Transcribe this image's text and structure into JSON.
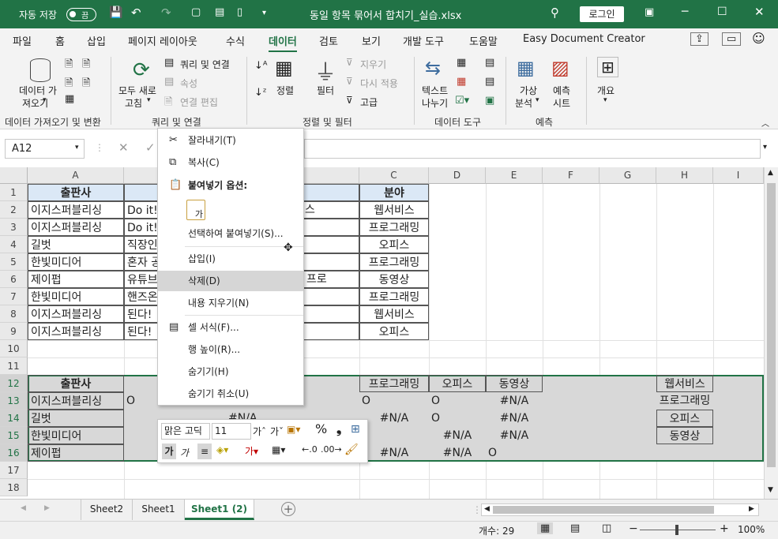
{
  "titlebar": {
    "autosave_label": "자동 저장",
    "autosave_state": "끔",
    "filename": "동일 항목 묶어서 합치기_실습.xlsx",
    "login_label": "로그인",
    "bg_color": "#217346"
  },
  "menu": {
    "items": [
      "파일",
      "홈",
      "삽입",
      "페이지 레이아웃",
      "수식",
      "데이터",
      "검토",
      "보기",
      "개발 도구",
      "도움말",
      "Easy Document Creator"
    ],
    "active": "데이터"
  },
  "ribbon": {
    "get_data_label1": "데이터 가",
    "get_data_label2": "져오기",
    "refresh_all_label1": "모두 새로",
    "refresh_all_label2": "고침",
    "queries_connections": "쿼리 및 연결",
    "properties": "속성",
    "edit_links": "연결 편집",
    "sort": "정렬",
    "filter": "필터",
    "clear": "지우기",
    "reapply": "다시 적용",
    "advanced": "고급",
    "text_to_columns1": "텍스트",
    "text_to_columns2": "나누기",
    "what_if1": "가상",
    "what_if2": "분석",
    "forecast1": "예측",
    "forecast2": "시트",
    "outline": "개요",
    "groups": [
      "데이터 가져오기 및 변환",
      "쿼리 및 연결",
      "정렬 및 필터",
      "데이터 도구",
      "예측"
    ]
  },
  "formula_bar": {
    "name_box": "A12"
  },
  "columns": [
    "A",
    "B",
    "C",
    "D",
    "E",
    "F",
    "G",
    "H",
    "I"
  ],
  "rows": [
    "1",
    "2",
    "3",
    "4",
    "5",
    "6",
    "7",
    "8",
    "9",
    "10",
    "11",
    "12",
    "13",
    "14",
    "15",
    "16",
    "17",
    "18"
  ],
  "table1": {
    "header_a": "출판사",
    "header_c": "분야",
    "rows": [
      {
        "a": "이지스퍼블리싱",
        "b": "Do it!",
        "b2": "스",
        "c": "웹서비스"
      },
      {
        "a": "이지스퍼블리싱",
        "b": "Do it!",
        "b2": "",
        "c": "프로그래밍"
      },
      {
        "a": "길벗",
        "b": "직장인",
        "b2": "",
        "c": "오피스"
      },
      {
        "a": "한빛미디어",
        "b": "혼자 공",
        "b2": "",
        "c": "프로그래밍"
      },
      {
        "a": "제이펍",
        "b": "유튜브",
        "b2": "프로",
        "c": "동영상"
      },
      {
        "a": "한빛미디어",
        "b": "핸즈온",
        "b2": "",
        "c": "프로그래밍"
      },
      {
        "a": "이지스퍼블리싱",
        "b": "된다!",
        "b2": "",
        "c": "웹서비스"
      },
      {
        "a": "이지스퍼블리싱",
        "b": "된다!",
        "b2": "",
        "c": "오피스"
      }
    ]
  },
  "table2": {
    "header_a": "출판사",
    "header_c": "프로그래밍",
    "header_d": "오피스",
    "header_e": "동영상",
    "rows": [
      {
        "a": "이지스퍼블리싱",
        "b": "O",
        "c": "O",
        "d": "O",
        "e": "#N/A"
      },
      {
        "a": "길벗",
        "b": "#N/A",
        "c": "#N/A",
        "d": "O",
        "e": "#N/A"
      },
      {
        "a": "한빛미디어",
        "b": "",
        "c": "",
        "d": "#N/A",
        "e": "#N/A"
      },
      {
        "a": "제이펍",
        "b": "",
        "c": "#N/A",
        "d": "#N/A",
        "e": "O"
      }
    ]
  },
  "side_list": [
    "웹서비스",
    "프로그래밍",
    "오피스",
    "동영상"
  ],
  "context_menu": {
    "items": [
      {
        "label": "잘라내기(T)",
        "icon": "scissors-icon"
      },
      {
        "label": "복사(C)",
        "icon": "copy-icon"
      },
      {
        "label": "붙여넣기 옵션:",
        "icon": "paste-icon"
      },
      {
        "label": "가",
        "icon": "paste-text-icon"
      },
      {
        "label": "선택하여 붙여넣기(S)...",
        "icon": ""
      },
      {
        "label": "삽입(I)",
        "icon": ""
      },
      {
        "label": "삭제(D)",
        "icon": ""
      },
      {
        "label": "내용 지우기(N)",
        "icon": ""
      },
      {
        "label": "셀 서식(F)...",
        "icon": "format-cells-icon"
      },
      {
        "label": "행 높이(R)...",
        "icon": ""
      },
      {
        "label": "숨기기(H)",
        "icon": ""
      },
      {
        "label": "숨기기 취소(U)",
        "icon": ""
      }
    ],
    "selected": "삭제(D)"
  },
  "mini_toolbar": {
    "font": "맑은 고딕",
    "size": "11",
    "bold": "가",
    "italic": "가"
  },
  "sheet_tabs": [
    "Sheet2",
    "Sheet1",
    "Sheet1 (2)"
  ],
  "active_tab": "Sheet1 (2)",
  "status": {
    "count": "개수: 29",
    "zoom": "100%"
  }
}
